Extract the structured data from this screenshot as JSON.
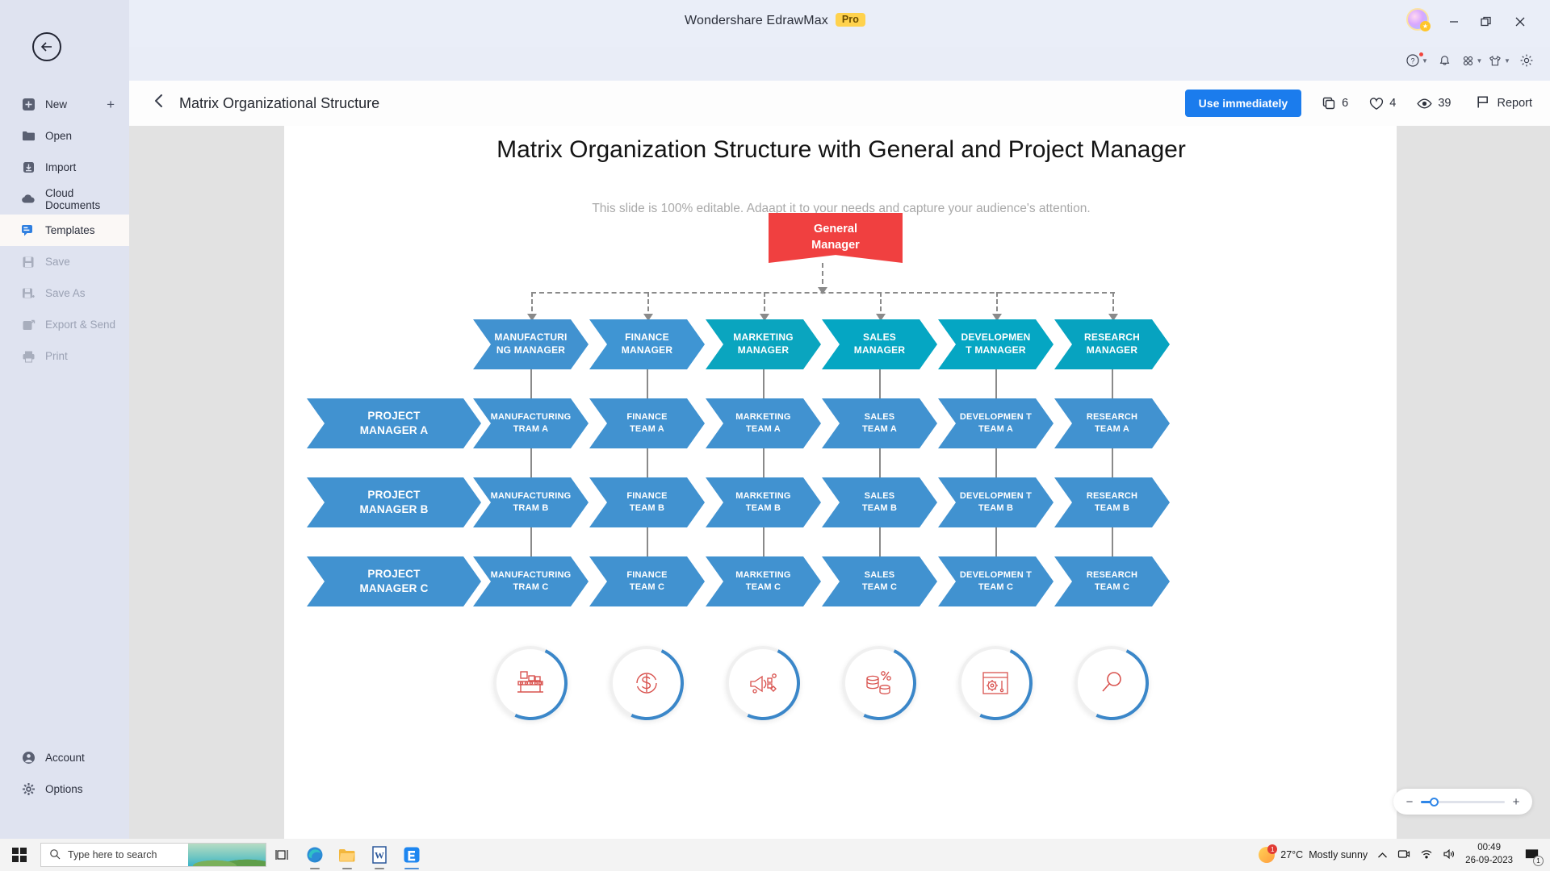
{
  "titlebar": {
    "app_name": "Wondershare EdrawMax",
    "pro_badge": "Pro",
    "minimize": "—",
    "maximize": "❐",
    "close": "✕"
  },
  "iconbar": [
    {
      "name": "help-icon",
      "glyph": "?",
      "has_dot": true,
      "caret": true
    },
    {
      "name": "bell-icon",
      "glyph": "⊙",
      "has_dot": false,
      "caret": false
    },
    {
      "name": "grid-apps-icon",
      "glyph": "∷",
      "has_dot": false,
      "caret": true
    },
    {
      "name": "theme-shirt-icon",
      "glyph": "▽",
      "has_dot": false,
      "caret": true
    },
    {
      "name": "gear-icon",
      "glyph": "⚙",
      "has_dot": false,
      "caret": false
    }
  ],
  "sidebar": {
    "back_label": "←",
    "add_label": "+",
    "items": [
      {
        "label": "New",
        "icon": "new-icon",
        "state": "normal"
      },
      {
        "label": "Open",
        "icon": "folder-icon",
        "state": "normal"
      },
      {
        "label": "Import",
        "icon": "import-icon",
        "state": "normal"
      },
      {
        "label": "Cloud Documents",
        "icon": "cloud-icon",
        "state": "normal"
      },
      {
        "label": "Templates",
        "icon": "templates-icon",
        "state": "active"
      },
      {
        "label": "Save",
        "icon": "save-icon",
        "state": "disabled"
      },
      {
        "label": "Save As",
        "icon": "save-as-icon",
        "state": "disabled"
      },
      {
        "label": "Export & Send",
        "icon": "export-icon",
        "state": "disabled"
      },
      {
        "label": "Print",
        "icon": "print-icon",
        "state": "disabled"
      }
    ],
    "bottom_items": [
      {
        "label": "Account",
        "icon": "account-icon"
      },
      {
        "label": "Options",
        "icon": "options-gear-icon"
      }
    ]
  },
  "template_header": {
    "back": "‹",
    "title": "Matrix Organizational Structure",
    "use_button": "Use immediately",
    "stats": [
      {
        "name": "copies",
        "icon": "copy-icon",
        "value": "6"
      },
      {
        "name": "likes",
        "icon": "heart-icon",
        "value": "4"
      },
      {
        "name": "views",
        "icon": "eye-icon",
        "value": "39"
      }
    ],
    "report_label": "Report"
  },
  "slide": {
    "title": "Matrix Organization Structure with General and Project Manager",
    "subtitle": "This slide is 100% editable. Adaapt it to your needs and capture your audience's attention."
  },
  "chart_data": {
    "type": "diagram",
    "diagram_kind": "matrix-organizational-chart",
    "title": "Matrix Organization Structure with General and Project Manager",
    "root": {
      "label": "General\nManager",
      "color": "#f04040",
      "shape": "ribbon"
    },
    "functional_managers": [
      {
        "label": "MANUFACTURI NG MANAGER",
        "color": "#4192d0"
      },
      {
        "label": "FINANCE MANAGER",
        "color": "#3f95d3"
      },
      {
        "label": "MARKETING MANAGER",
        "color": "#0aa5bf"
      },
      {
        "label": "SALES MANAGER",
        "color": "#05a6c3"
      },
      {
        "label": "DEVELOPMEN T MANAGER",
        "color": "#05a6c3"
      },
      {
        "label": "RESEARCH MANAGER",
        "color": "#07a3c0"
      }
    ],
    "project_managers": [
      {
        "label": "PROJECT MANAGER A",
        "color": "#4192d0"
      },
      {
        "label": "PROJECT MANAGER B",
        "color": "#4192d0"
      },
      {
        "label": "PROJECT MANAGER C",
        "color": "#4192d0"
      }
    ],
    "matrix_rows": [
      {
        "row": "A",
        "cells": [
          "MANUFACTURING TRAM A",
          "FINANCE TEAM A",
          "MARKETING TEAM A",
          "SALES TEAM A",
          "DEVELOPMEN T TEAM A",
          "RESEARCH TEAM A"
        ]
      },
      {
        "row": "B",
        "cells": [
          "MANUFACTURING TRAM B",
          "FINANCE TEAM B",
          "MARKETING TEAM B",
          "SALES TEAM B",
          "DEVELOPMEN T TEAM B",
          "RESEARCH TEAM B"
        ]
      },
      {
        "row": "C",
        "cells": [
          "MANUFACTURING TRAM C",
          "FINANCE TEAM C",
          "MARKETING TEAM C",
          "SALES TEAM C",
          "DEVELOPMEN T TEAM C",
          "RESEARCH TEAM C"
        ]
      }
    ],
    "footer_icons": [
      {
        "name": "conveyor-belt-icon",
        "glyph": "☷"
      },
      {
        "name": "dollar-cycle-icon",
        "glyph": "$"
      },
      {
        "name": "megaphone-icon",
        "glyph": "◤"
      },
      {
        "name": "coins-percent-icon",
        "glyph": "%"
      },
      {
        "name": "settings-window-icon",
        "glyph": "⚙"
      },
      {
        "name": "magnifier-icon",
        "glyph": "⚲"
      }
    ],
    "connector_color": "#8a8a8a",
    "text_color": "#ffffff"
  },
  "zoom_control": {
    "minus": "−",
    "plus": "+"
  },
  "taskbar": {
    "search_placeholder": "Type here to search",
    "apps": [
      {
        "name": "task-view-icon",
        "glyph": "▣"
      },
      {
        "name": "edge-browser-icon",
        "glyph": "e"
      },
      {
        "name": "file-explorer-icon",
        "glyph": "὜1"
      },
      {
        "name": "word-icon",
        "glyph": "W"
      },
      {
        "name": "edrawmax-icon",
        "glyph": "Đ"
      }
    ],
    "tray": {
      "temperature": "27°C",
      "weather": "Mostly sunny",
      "weather_badge": "1",
      "chevron": "∧",
      "onedrive": "☁",
      "network": "◔",
      "volume": "ὐA",
      "time": "00:49",
      "date": "26-09-2023",
      "notification_count": "1"
    }
  }
}
